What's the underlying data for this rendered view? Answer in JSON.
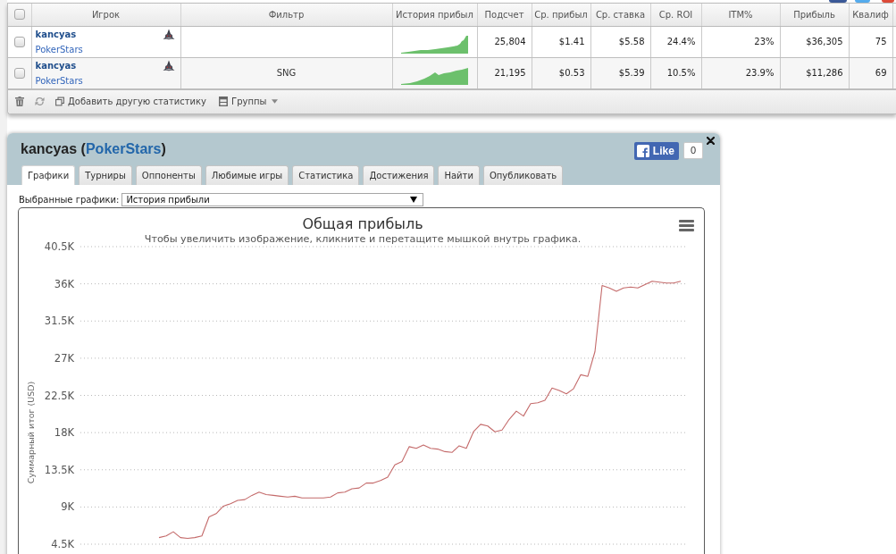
{
  "stats_table": {
    "select_all": {
      "checked": false
    },
    "columns": [
      "Игрок",
      "Фильтр",
      "История прибыл",
      "Подсчет",
      "Ср. прибыл",
      "Ср. ставка",
      "Ср. ROI",
      "ITM%",
      "Прибыль",
      "Квалиф"
    ],
    "rows": [
      {
        "checked": false,
        "cells": [
          {
            "kind": "player",
            "name": "kancyas",
            "site": "PokerStars"
          },
          "",
          {
            "kind": "sparkline"
          },
          "25,804",
          "$1.41",
          "$5.58",
          "24.4%",
          "23%",
          "$36,305",
          "75"
        ]
      },
      {
        "checked": false,
        "cells": [
          {
            "kind": "player",
            "name": "kancyas",
            "site": "PokerStars"
          },
          "SNG",
          {
            "kind": "sparkline"
          },
          "21,195",
          "$0.53",
          "$5.39",
          "10.5%",
          "23.9%",
          "$11,286",
          "69"
        ]
      }
    ],
    "toolbar": {
      "add_stat": "Добавить другую статистику",
      "groups": "Группы"
    }
  },
  "player_panel": {
    "title": {
      "prefix": "kancyas (",
      "link": "PokerStars",
      "suffix": ")"
    },
    "like": {
      "label": "Like",
      "count": "0"
    },
    "tabs": [
      {
        "label": "Графики",
        "selected": true
      },
      {
        "label": "Турниры",
        "selected": false
      },
      {
        "label": "Оппоненты",
        "selected": false
      },
      {
        "label": "Любимые игры",
        "selected": false
      },
      {
        "label": "Статистика",
        "selected": false
      },
      {
        "label": "Достижения",
        "selected": false
      },
      {
        "label": "Найти",
        "selected": false
      },
      {
        "label": "Опубликовать",
        "selected": false
      }
    ],
    "chart_picker": {
      "label": "Выбранные графики:",
      "value": "История прибыли"
    },
    "chart": {
      "subtitle": "Чтобы увеличить изображение, кликните и перетащите мышкой внутрь графика.",
      "chart_data": {
        "type": "line",
        "title": "Общая прибыль",
        "ylabel": "Суммарный итог (USD)",
        "ylim": [
          4500,
          40500
        ],
        "grid": true,
        "yticks": [
          {
            "value": 4500,
            "label": "4.5K"
          },
          {
            "value": 9000,
            "label": "9K"
          },
          {
            "value": 13500,
            "label": "13.5K"
          },
          {
            "value": 18000,
            "label": "18K"
          },
          {
            "value": 22500,
            "label": "22.5K"
          },
          {
            "value": 27000,
            "label": "27K"
          },
          {
            "value": 31500,
            "label": "31.5K"
          },
          {
            "value": 36000,
            "label": "36K"
          },
          {
            "value": 40500,
            "label": "40.5K"
          }
        ],
        "values": [
          null,
          null,
          null,
          null,
          null,
          null,
          null,
          null,
          null,
          null,
          null,
          5300,
          5500,
          6000,
          5300,
          5200,
          5300,
          5500,
          7800,
          8200,
          9100,
          9400,
          9800,
          9900,
          10400,
          10800,
          10500,
          10400,
          10300,
          10200,
          10300,
          10100,
          10100,
          10100,
          10100,
          10200,
          10700,
          10800,
          11200,
          11300,
          11900,
          11900,
          12200,
          12600,
          14100,
          14500,
          16300,
          16100,
          16500,
          16100,
          16000,
          15700,
          15600,
          16400,
          16100,
          18100,
          19000,
          18800,
          18100,
          18300,
          19600,
          20600,
          20000,
          21500,
          21600,
          21900,
          23400,
          23100,
          22700,
          23300,
          25000,
          24800,
          27800,
          35800,
          35500,
          35100,
          35500,
          35600,
          35500,
          35900,
          36300,
          36200,
          36100,
          36100,
          36300
        ]
      }
    }
  }
}
